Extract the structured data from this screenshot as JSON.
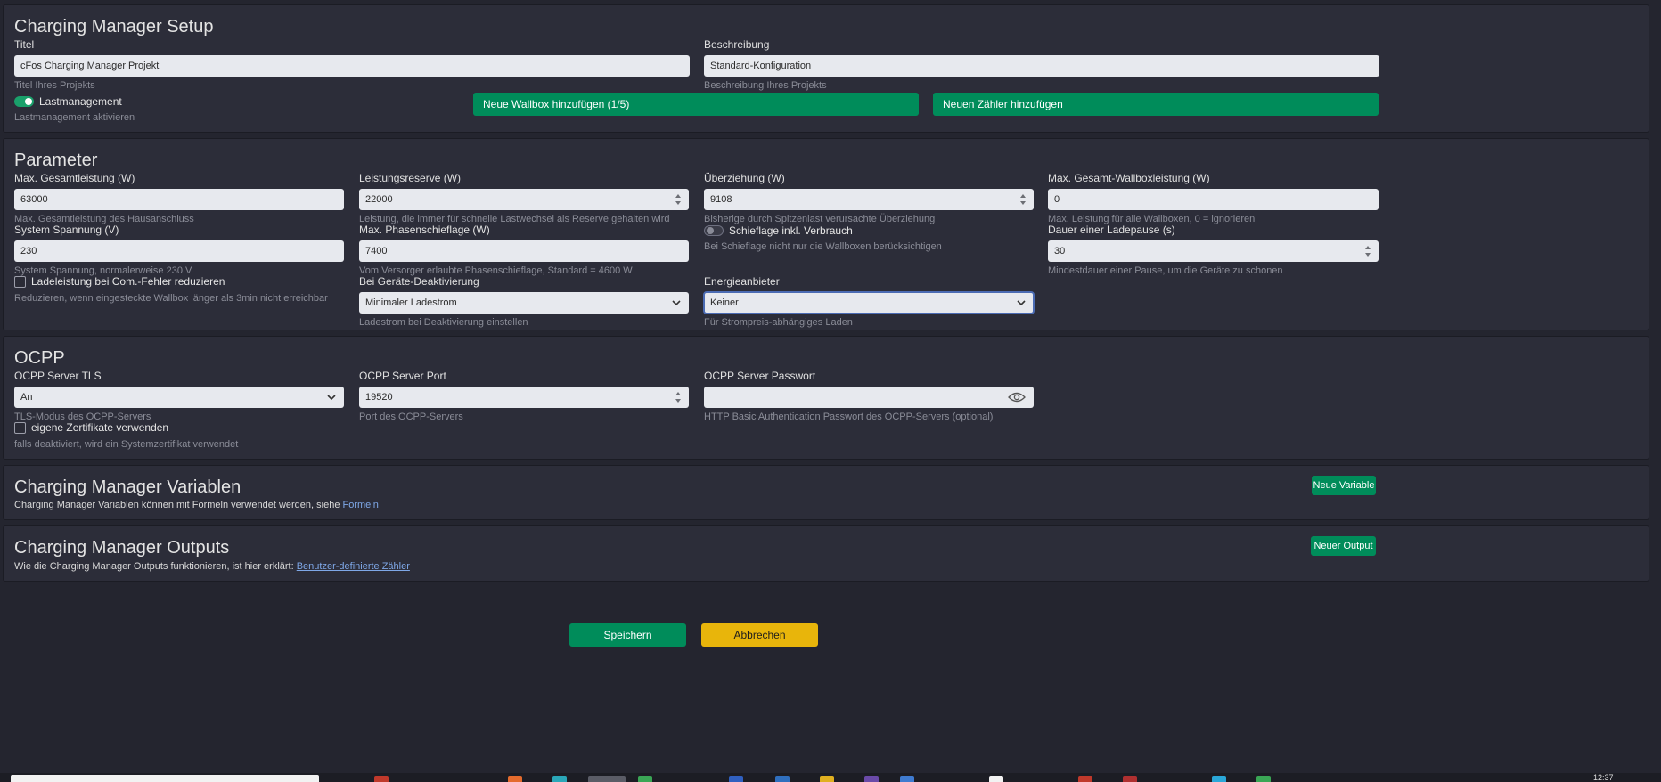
{
  "setup": {
    "title": "Charging Manager Setup",
    "titel": {
      "label": "Titel",
      "value": "cFos Charging Manager Projekt",
      "help": "Titel Ihres Projekts"
    },
    "beschreibung": {
      "label": "Beschreibung",
      "value": "Standard-Konfiguration",
      "help": "Beschreibung Ihres Projekts"
    },
    "lastmanagement": {
      "label": "Lastmanagement",
      "help": "Lastmanagement aktivieren",
      "enabled": true
    },
    "add_wallbox_label": "Neue Wallbox hinzufügen (1/5)",
    "add_meter_label": "Neuen Zähler hinzufügen"
  },
  "parameter": {
    "title": "Parameter",
    "max_gesamtleistung": {
      "label": "Max. Gesamtleistung (W)",
      "value": "63000",
      "help": "Max. Gesamtleistung des Hausanschluss"
    },
    "leistungsreserve": {
      "label": "Leistungsreserve (W)",
      "value": "22000",
      "help": "Leistung, die immer für schnelle Lastwechsel als Reserve gehalten wird"
    },
    "ueberziehung": {
      "label": "Überziehung (W)",
      "value": "9108",
      "help": "Bisherige durch Spitzenlast verursachte Überziehung"
    },
    "max_wallboxleistung": {
      "label": "Max. Gesamt-Wallboxleistung (W)",
      "value": "0",
      "help": "Max. Leistung für alle Wallboxen, 0 = ignorieren"
    },
    "system_spannung": {
      "label": "System Spannung (V)",
      "value": "230",
      "help": "System Spannung, normalerweise 230 V"
    },
    "phasenschieflage": {
      "label": "Max. Phasenschieflage (W)",
      "value": "7400",
      "help": "Vom Versorger erlaubte Phasenschieflage, Standard = 4600 W"
    },
    "schieflage_verbrauch": {
      "label": "Schieflage inkl. Verbrauch",
      "help": "Bei Schieflage nicht nur die Wallboxen berücksichtigen",
      "enabled": false
    },
    "ladepause": {
      "label": "Dauer einer Ladepause (s)",
      "value": "30",
      "help": "Mindestdauer einer Pause, um die Geräte zu schonen"
    },
    "ladeleistung_reduzieren": {
      "label": "Ladeleistung bei Com.-Fehler reduzieren",
      "help": "Reduzieren, wenn eingesteckte Wallbox länger als 3min nicht erreichbar",
      "checked": false
    },
    "geraete_deaktivierung": {
      "label": "Bei Geräte-Deaktivierung",
      "value": "Minimaler Ladestrom",
      "help": "Ladestrom bei Deaktivierung einstellen"
    },
    "energieanbieter": {
      "label": "Energieanbieter",
      "value": "Keiner",
      "help": "Für Strompreis-abhängiges Laden"
    }
  },
  "ocpp": {
    "title": "OCPP",
    "tls": {
      "label": "OCPP Server TLS",
      "value": "An",
      "help": "TLS-Modus des OCPP-Servers"
    },
    "port": {
      "label": "OCPP Server Port",
      "value": "19520",
      "help": "Port des OCPP-Servers"
    },
    "passwort": {
      "label": "OCPP Server Passwort",
      "value": "",
      "help": "HTTP Basic Authentication Passwort des OCPP-Servers (optional)"
    },
    "eigene_zertifikate": {
      "label": "eigene Zertifikate verwenden",
      "help": "falls deaktiviert, wird ein Systemzertifikat verwendet",
      "checked": false
    }
  },
  "variablen": {
    "title": "Charging Manager Variablen",
    "text": "Charging Manager Variablen können mit Formeln verwendet werden, siehe ",
    "link": "Formeln",
    "button": "Neue Variable"
  },
  "outputs": {
    "title": "Charging Manager Outputs",
    "text": "Wie die Charging Manager Outputs funktionieren, ist hier erklärt: ",
    "link": "Benutzer-definierte Zähler",
    "button": "Neuer Output"
  },
  "footer": {
    "save_label": "Speichern",
    "cancel_label": "Abbrechen"
  },
  "taskbar": {
    "clock": "12:37"
  },
  "colors": {
    "accent_green": "#008c5a",
    "cancel_yellow": "#e8b50b",
    "panel_bg": "#2c2d39",
    "page_bg": "#24252f"
  }
}
